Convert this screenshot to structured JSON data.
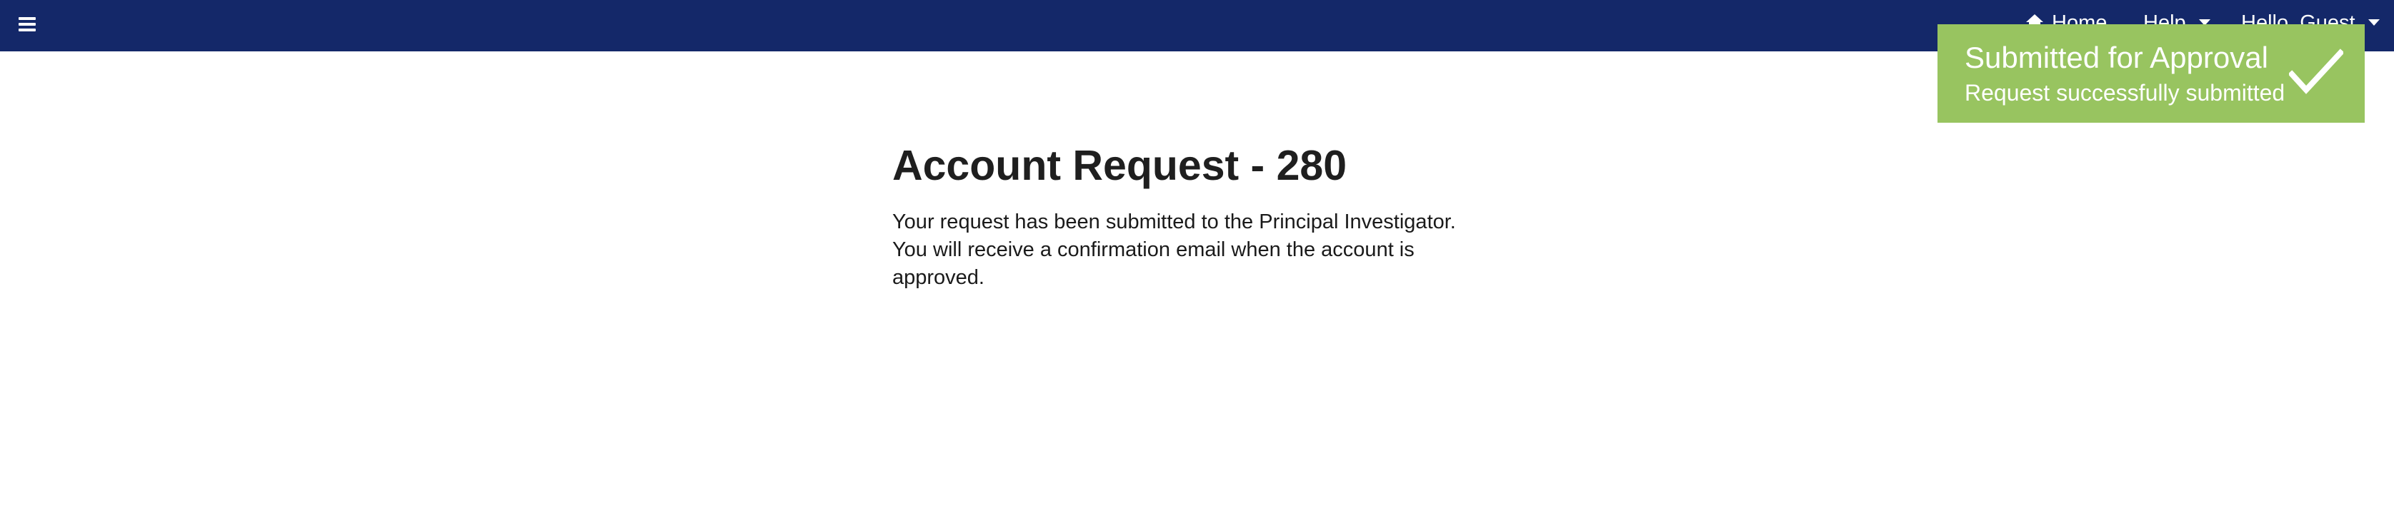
{
  "nav": {
    "menu_icon": "hamburger-icon",
    "home_label": "Home",
    "home_icon": "home-icon",
    "help_label": "Help",
    "user_label": "Hello, Guest",
    "caret_icon": "caret-down-icon"
  },
  "toast": {
    "title": "Submitted for Approval",
    "message": "Request successfully submitted",
    "icon": "checkmark-icon",
    "background_color": "#98c460"
  },
  "main": {
    "title": "Account Request - 280",
    "message": "Your request has been submitted to the Principal Investigator. You will receive a confirmation email when the account is approved."
  },
  "colors": {
    "topbar": "#142869",
    "toast": "#98c460"
  }
}
